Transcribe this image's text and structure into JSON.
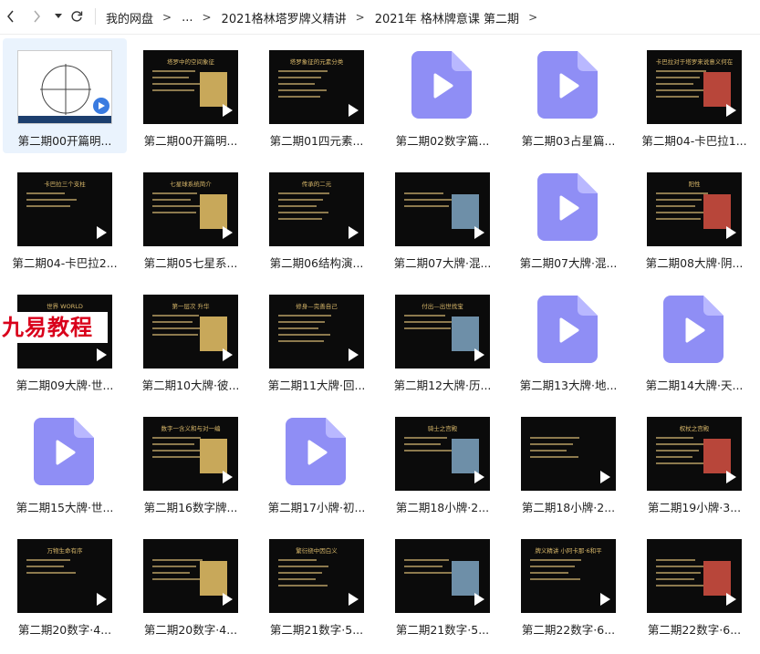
{
  "nav": {
    "back_icon": "chevron-left-icon",
    "forward_icon": "chevron-right-icon",
    "dropdown_icon": "caret-down-icon",
    "refresh_icon": "refresh-icon"
  },
  "breadcrumbs": [
    "我的网盘",
    "...",
    "2021格林塔罗牌义精讲",
    "2021年 格林牌意课 第二期"
  ],
  "breadcrumb_separator": ">",
  "watermark": "九易教程",
  "colors": {
    "video_icon": "#8f8ef5",
    "selected_bg": "#eaf3fd",
    "thumb_title": "#d9b86a"
  },
  "files": [
    {
      "name": "第二期00开篇明...",
      "kind": "thumb"
    },
    {
      "name": "第二期00开篇明...",
      "kind": "thumb",
      "title": "塔罗中的空间象征"
    },
    {
      "name": "第二期01四元素...",
      "kind": "thumb",
      "title": "塔罗象征的元素分类"
    },
    {
      "name": "第二期02数字篇...",
      "kind": "video"
    },
    {
      "name": "第二期03占星篇...",
      "kind": "video"
    },
    {
      "name": "第二期04-卡巴拉1...",
      "kind": "thumb",
      "title": "卡巴拉对于塔罗来说意义何在"
    },
    {
      "name": "第二期04-卡巴拉2...",
      "kind": "thumb",
      "title": "卡巴拉三个支柱"
    },
    {
      "name": "第二期05七星系...",
      "kind": "thumb",
      "title": "七星球系统简介"
    },
    {
      "name": "第二期06结构演...",
      "kind": "thumb",
      "title": "传承的二元"
    },
    {
      "name": "第二期07大牌·混...",
      "kind": "thumb"
    },
    {
      "name": "第二期07大牌·混...",
      "kind": "video"
    },
    {
      "name": "第二期08大牌·阴...",
      "kind": "thumb",
      "title": "阳性"
    },
    {
      "name": "第二期09大牌·世...",
      "kind": "thumb",
      "title": "世界 WORLD"
    },
    {
      "name": "第二期10大牌·彼...",
      "kind": "thumb",
      "title": "第一层次 升华"
    },
    {
      "name": "第二期11大牌·回...",
      "kind": "thumb",
      "title": "修身—完善自己"
    },
    {
      "name": "第二期12大牌·历...",
      "kind": "thumb",
      "title": "付出—出世找宝"
    },
    {
      "name": "第二期13大牌·地...",
      "kind": "video"
    },
    {
      "name": "第二期14大牌·天...",
      "kind": "video"
    },
    {
      "name": "第二期15大牌·世...",
      "kind": "video"
    },
    {
      "name": "第二期16数字牌...",
      "kind": "thumb",
      "title": "数字一含义和与对一编"
    },
    {
      "name": "第二期17小牌·初...",
      "kind": "video"
    },
    {
      "name": "第二期18小牌·2...",
      "kind": "thumb",
      "title": "骑士之宫殿"
    },
    {
      "name": "第二期18小牌·2...",
      "kind": "thumb"
    },
    {
      "name": "第二期19小牌·3...",
      "kind": "thumb",
      "title": "权杖之宫殿"
    },
    {
      "name": "第二期20数字·4...",
      "kind": "thumb",
      "title": "万物生命有序"
    },
    {
      "name": "第二期20数字·4...",
      "kind": "thumb"
    },
    {
      "name": "第二期21数字·5...",
      "kind": "thumb",
      "title": "繁衍绕中因白义"
    },
    {
      "name": "第二期21数字·5...",
      "kind": "thumb"
    },
    {
      "name": "第二期22数字·6...",
      "kind": "thumb",
      "title": "牌义精讲 小阿卡那·6和平"
    },
    {
      "name": "第二期22数字·6...",
      "kind": "thumb"
    }
  ]
}
